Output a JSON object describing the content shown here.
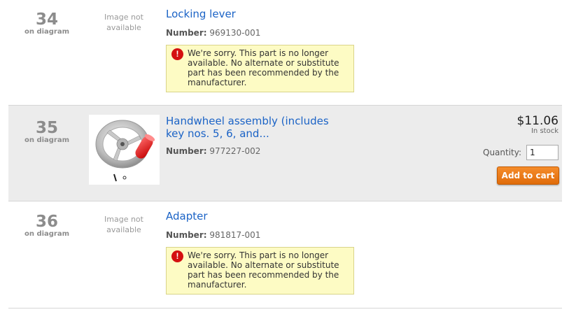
{
  "parts": [
    {
      "diagram_number": "34",
      "diagram_sub": "on diagram",
      "image_text": "Image not available",
      "title": "Locking lever",
      "number_label": "Number:",
      "number": "969130-001",
      "notice": "We're sorry. This part is no longer available. No alternate or substitute part has been recommended by the manufacturer."
    },
    {
      "diagram_number": "35",
      "diagram_sub": "on diagram",
      "title": "Handwheel assembly (includes key nos. 5, 6, and...",
      "number_label": "Number:",
      "number": "977227-002",
      "price": "$11.06",
      "stock": "In stock",
      "quantity_label": "Quantity:",
      "quantity_value": "1",
      "add_to_cart": "Add to cart"
    },
    {
      "diagram_number": "36",
      "diagram_sub": "on diagram",
      "image_text": "Image not available",
      "title": "Adapter",
      "number_label": "Number:",
      "number": "981817-001",
      "notice": "We're sorry. This part is no longer available. No alternate or substitute part has been recommended by the manufacturer."
    }
  ],
  "icons": {
    "warning": "exclamation-circle-icon"
  },
  "colors": {
    "link": "#1b63c6",
    "notice_bg": "#fdfbc4",
    "button": "#e8750f",
    "warning": "#d41010"
  }
}
